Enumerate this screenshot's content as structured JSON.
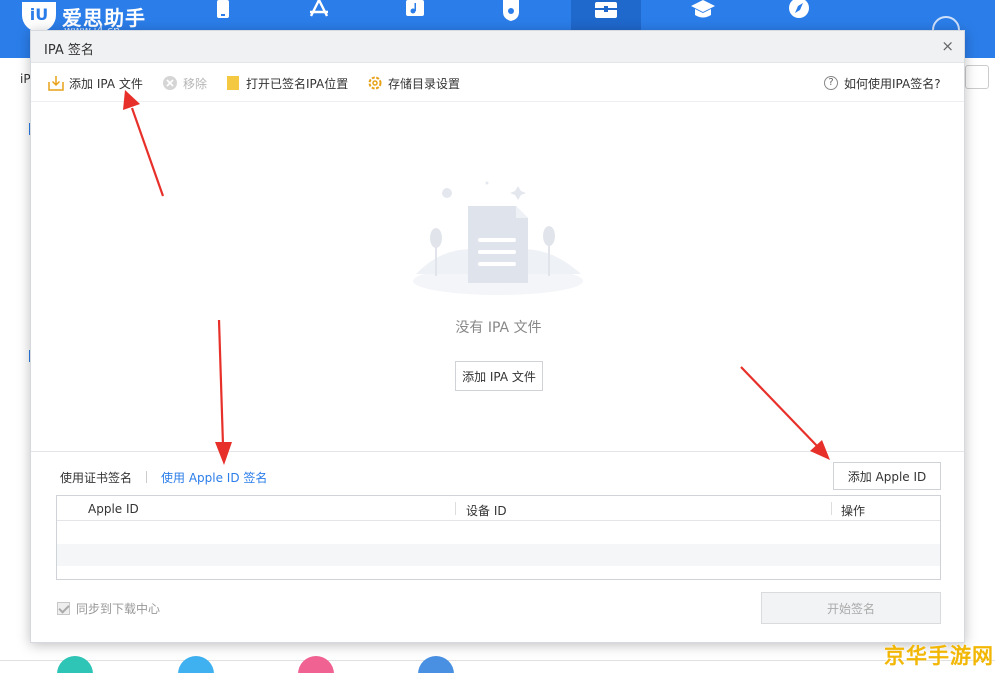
{
  "app": {
    "brand_name": "爱思助手",
    "brand_url": "www.i4.cn",
    "logo_text": "iU",
    "bg_left_text": "iP",
    "nav_icons": [
      "phone-icon",
      "app-store-icon",
      "music-icon",
      "ringtone-icon",
      "toolbox-icon",
      "tutorial-icon",
      "compass-icon"
    ],
    "active_nav": "toolbox-icon",
    "accent_color": "#2b7de9"
  },
  "dialog": {
    "title": "IPA 签名",
    "close_glyph": "×"
  },
  "toolbar": {
    "add_ipa": "添加 IPA 文件",
    "remove": "移除",
    "open_signed": "打开已签名IPA位置",
    "storage_settings": "存储目录设置",
    "help": "如何使用IPA签名?",
    "help_glyph": "?"
  },
  "empty_state": {
    "text": "没有 IPA 文件",
    "add_button": "添加 IPA 文件"
  },
  "tabs": {
    "cert_sign": "使用证书签名",
    "apple_id_sign": "使用 Apple ID 签名",
    "active": "apple_id_sign"
  },
  "add_apple_id_button": "添加 Apple ID",
  "table": {
    "columns": [
      "Apple ID",
      "设备 ID",
      "操作"
    ],
    "rows": []
  },
  "sync_checkbox": {
    "label": "同步到下载中心",
    "checked": true
  },
  "start_sign_button": "开始签名",
  "watermark": "京华手游网",
  "annotation_color": "#e8302a"
}
